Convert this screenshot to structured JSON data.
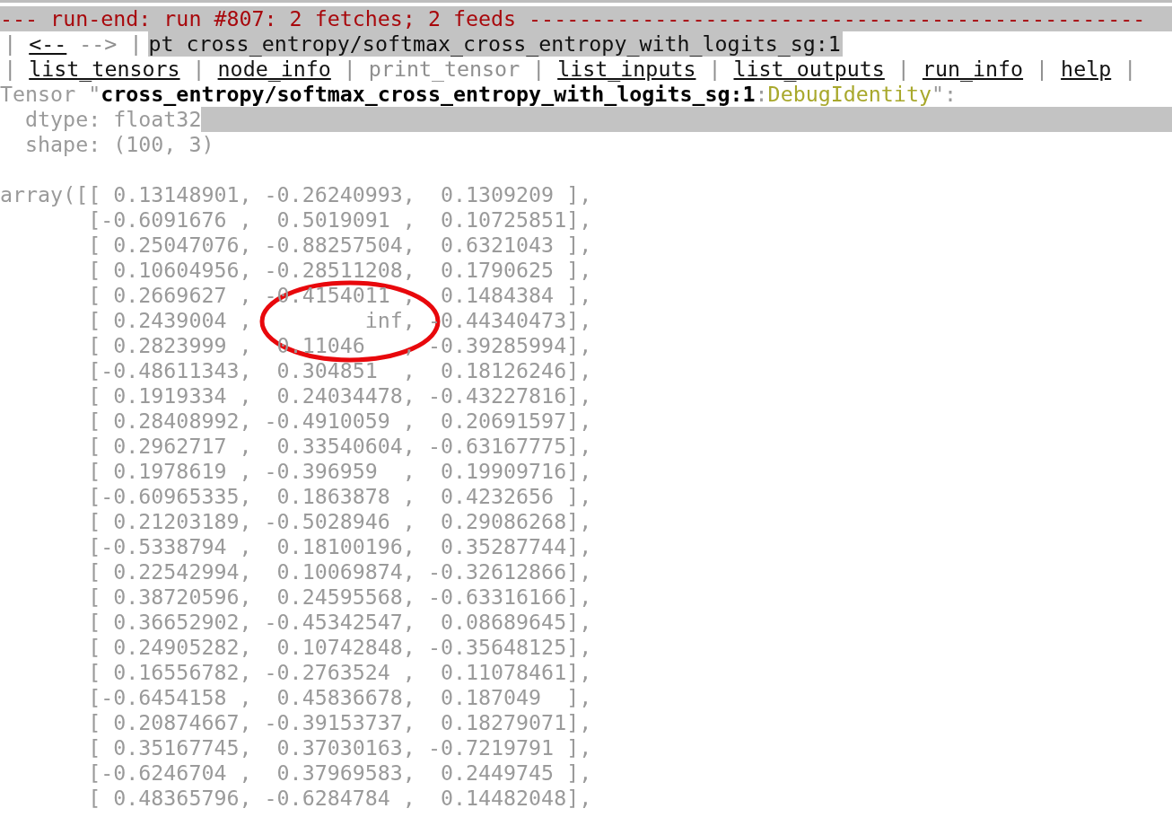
{
  "header": {
    "text": "--- run-end: run #807: 2 fetches; 2 feeds -------------------------------------------------"
  },
  "nav": {
    "separator": "|",
    "back": {
      "label": "<--",
      "disabled": false
    },
    "forward": {
      "label": "-->",
      "disabled": true
    },
    "command": "pt cross_entropy/softmax_cross_entropy_with_logits_sg:1"
  },
  "menu": {
    "separator": "|",
    "items": [
      {
        "label": "list_tensors",
        "disabled": false
      },
      {
        "label": "node_info",
        "disabled": false
      },
      {
        "label": "print_tensor",
        "disabled": true
      },
      {
        "label": "list_inputs",
        "disabled": false
      },
      {
        "label": "list_outputs",
        "disabled": false
      },
      {
        "label": "run_info",
        "disabled": false
      },
      {
        "label": "help",
        "disabled": false
      }
    ]
  },
  "tensor": {
    "prefix": "Tensor \"",
    "name": "cross_entropy/softmax_cross_entropy_with_logits_sg:1",
    "colon": ":",
    "op": "DebugIdentity",
    "suffix": "\":"
  },
  "details": [
    {
      "text": "dtype: float32",
      "highlighted": true
    },
    {
      "text": "shape: (100, 3)",
      "highlighted": false
    }
  ],
  "array": {
    "prefix": "array([",
    "rows": [
      "[ 0.13148901, -0.26240993,  0.1309209 ],",
      "[-0.6091676 ,  0.5019091 ,  0.10725851],",
      "[ 0.25047076, -0.88257504,  0.6321043 ],",
      "[ 0.10604956, -0.28511208,  0.1790625 ],",
      "[ 0.2669627 , -0.4154011 ,  0.1484384 ],",
      "[ 0.2439004 ,         inf, -0.44340473],",
      "[ 0.2823999 ,  0.11046   , -0.39285994],",
      "[-0.48611343,  0.304851  ,  0.18126246],",
      "[ 0.1919334 ,  0.24034478, -0.43227816],",
      "[ 0.28408992, -0.4910059 ,  0.20691597],",
      "[ 0.2962717 ,  0.33540604, -0.63167775],",
      "[ 0.1978619 , -0.396959  ,  0.19909716],",
      "[-0.60965335,  0.1863878 ,  0.4232656 ],",
      "[ 0.21203189, -0.5028946 ,  0.29086268],",
      "[-0.5338794 ,  0.18100196,  0.35287744],",
      "[ 0.22542994,  0.10069874, -0.32612866],",
      "[ 0.38720596,  0.24595568, -0.63316166],",
      "[ 0.36652902, -0.45342547,  0.08689645],",
      "[ 0.24905282,  0.10742848, -0.35648125],",
      "[ 0.16556782, -0.2763524 ,  0.11078461],",
      "[-0.6454158 ,  0.45836678,  0.187049  ],",
      "[ 0.20874667, -0.39153737,  0.18279071],",
      "[ 0.35167745,  0.37030163, -0.7219791 ],",
      "[-0.6246704 ,  0.37969583,  0.2449745 ],",
      "[ 0.48365796, -0.6284784 ,  0.14482048],"
    ]
  }
}
